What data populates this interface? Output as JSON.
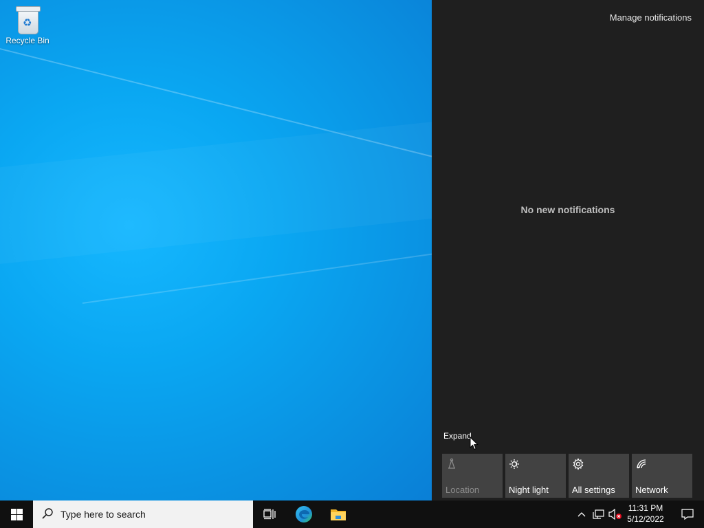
{
  "desktop": {
    "icons": [
      {
        "label": "Recycle Bin",
        "icon": "recycle-bin-icon"
      }
    ]
  },
  "action_center": {
    "manage_link": "Manage notifications",
    "empty_message": "No new notifications",
    "expand_label": "Expand",
    "quick_actions": [
      {
        "label": "Location",
        "icon": "location-icon",
        "enabled": false
      },
      {
        "label": "Night light",
        "icon": "night-light-icon",
        "enabled": true
      },
      {
        "label": "All settings",
        "icon": "gear-icon",
        "enabled": true
      },
      {
        "label": "Network",
        "icon": "network-icon",
        "enabled": true
      }
    ]
  },
  "taskbar": {
    "search_placeholder": "Type here to search",
    "pinned": [
      {
        "name": "task-view",
        "icon": "task-view-icon"
      },
      {
        "name": "edge",
        "icon": "edge-icon"
      },
      {
        "name": "file-explorer",
        "icon": "folder-icon"
      }
    ],
    "tray": {
      "icons": [
        "chevron-up-icon",
        "network-wired-icon",
        "speaker-muted-icon"
      ],
      "time": "11:31 PM",
      "date": "5/12/2022"
    }
  },
  "colors": {
    "desktop_blue": "#0aa7f2",
    "action_center_bg": "#1f1f1f",
    "tile_bg": "#424242",
    "taskbar_bg": "#101010"
  }
}
